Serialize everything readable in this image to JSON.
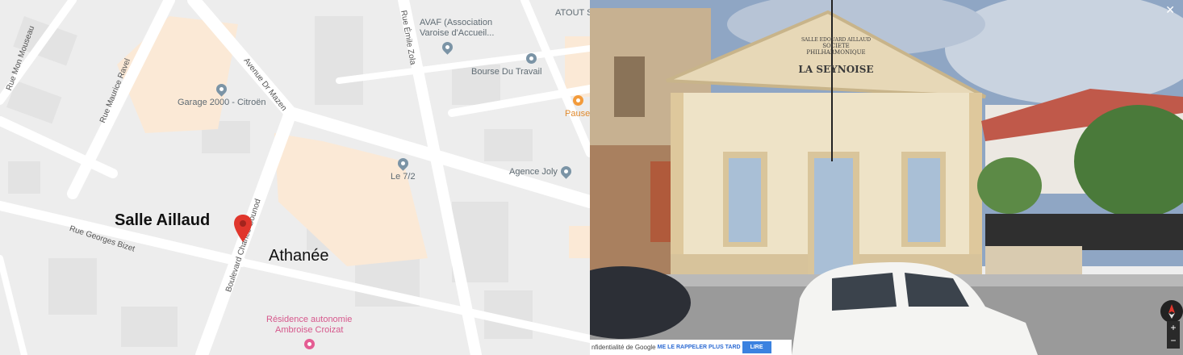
{
  "map": {
    "roads": [
      "Rue Mon Mouseau",
      "Rue Maurice Ravel",
      "Avenue Dr Mazen",
      "Rue Émile Zola",
      "Rue Georges Bizet",
      "Boulevard Charles Gounod"
    ],
    "pois": [
      {
        "label": "Garage 2000 - Citroën",
        "icon": "map-pin-icon"
      },
      {
        "label": "AVAF (Association\nVaroise d'Accueil...",
        "icon": "map-pin-icon"
      },
      {
        "label": "Bourse Du Travail",
        "icon": "building-icon"
      },
      {
        "label": "Pause",
        "icon": "restaurant-icon"
      },
      {
        "label": "ATOUT S",
        "icon": ""
      },
      {
        "label": "Le 7/2",
        "icon": "map-pin-icon"
      },
      {
        "label": "Agence Joly",
        "icon": "map-pin-icon"
      },
      {
        "label": "Résidence autonomie\nAmbroise Croizat",
        "icon": "residence-icon"
      }
    ],
    "overlay": {
      "marker_label": "Salle Aillaud",
      "secondary_label": "Athanée"
    },
    "marker_icon": "red-location-marker-icon"
  },
  "streetview": {
    "facade_lines": [
      "SALLE EDOUARD AILLAUD",
      "SOCIETE PHILHARMONIQUE",
      "LA SEYNOISE"
    ],
    "consent": {
      "text": "nfidentialité de Google",
      "later_button": "ME LE RAPPELER PLUS TARD",
      "read_button": "LIRE"
    },
    "close_icon": "close-icon",
    "zoom_in": "+",
    "zoom_out": "−"
  },
  "colors": {
    "map_bg": "#ededed",
    "road": "#ffffff",
    "highlight_area": "#fbe9d6",
    "marker": "#e0362c",
    "accent_blue": "#3b82e0"
  }
}
